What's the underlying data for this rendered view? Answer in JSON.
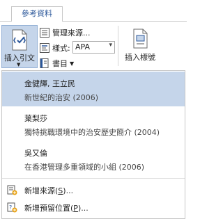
{
  "ribbon": {
    "tab_label": "參考資料",
    "insert_citation_label": "插入引文",
    "manage_sources_label": "管理來源...",
    "style_label": "樣式:",
    "style_value": "APA",
    "bibliography_label": "書目",
    "insert_caption_label": "插入標號"
  },
  "citations": [
    {
      "author": "金健輝, 王立民",
      "title": "新世紀的治安 (2006)",
      "selected": true
    },
    {
      "author": "葉梨莎",
      "title": "獨特挑戰環境中的治安歷史簡介 (2004)",
      "selected": false
    },
    {
      "author": "吳又倫",
      "title": "在香港管理多重領域的小組 (2006)",
      "selected": false
    }
  ],
  "commands": {
    "add_source_prefix": "新增來源(",
    "add_source_key": "S",
    "add_source_suffix": ")...",
    "add_placeholder_prefix": "新增預留位置(",
    "add_placeholder_key": "P",
    "add_placeholder_suffix": ")..."
  },
  "colors": {
    "accent": "#2b579a",
    "selection": "#c5d5ea",
    "border": "#c6c6c6"
  }
}
